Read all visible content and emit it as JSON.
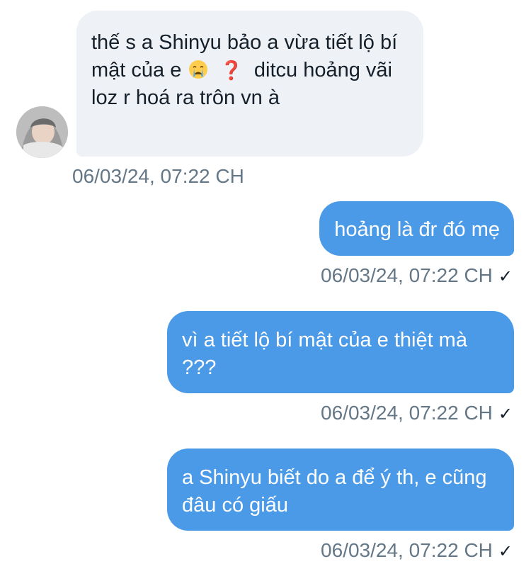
{
  "messages": [
    {
      "direction": "incoming",
      "text_before": "thế s a Shinyu bảo a vừa tiết lộ bí mật của e",
      "emoji": "crying-face-icon",
      "question_mark": "❓",
      "text_after": "ditcu hoảng vãi loz r hoá ra trôn vn à",
      "timestamp": "06/03/24, 07:22 CH"
    },
    {
      "direction": "outgoing",
      "text": "hoảng là đr đó mẹ",
      "timestamp": "06/03/24, 07:22 CH",
      "status": "✓"
    },
    {
      "direction": "outgoing",
      "text": "vì a tiết lộ bí mật của e thiệt mà ???",
      "timestamp": "06/03/24, 07:22 CH",
      "status": "✓"
    },
    {
      "direction": "outgoing",
      "text": "a Shinyu biết do a để ý th, e cũng đâu có giấu",
      "timestamp": "06/03/24, 07:22 CH",
      "status": "✓"
    }
  ],
  "colors": {
    "incoming_bubble": "#eef1f5",
    "outgoing_bubble": "#4a9ae8",
    "timestamp": "#647787"
  }
}
